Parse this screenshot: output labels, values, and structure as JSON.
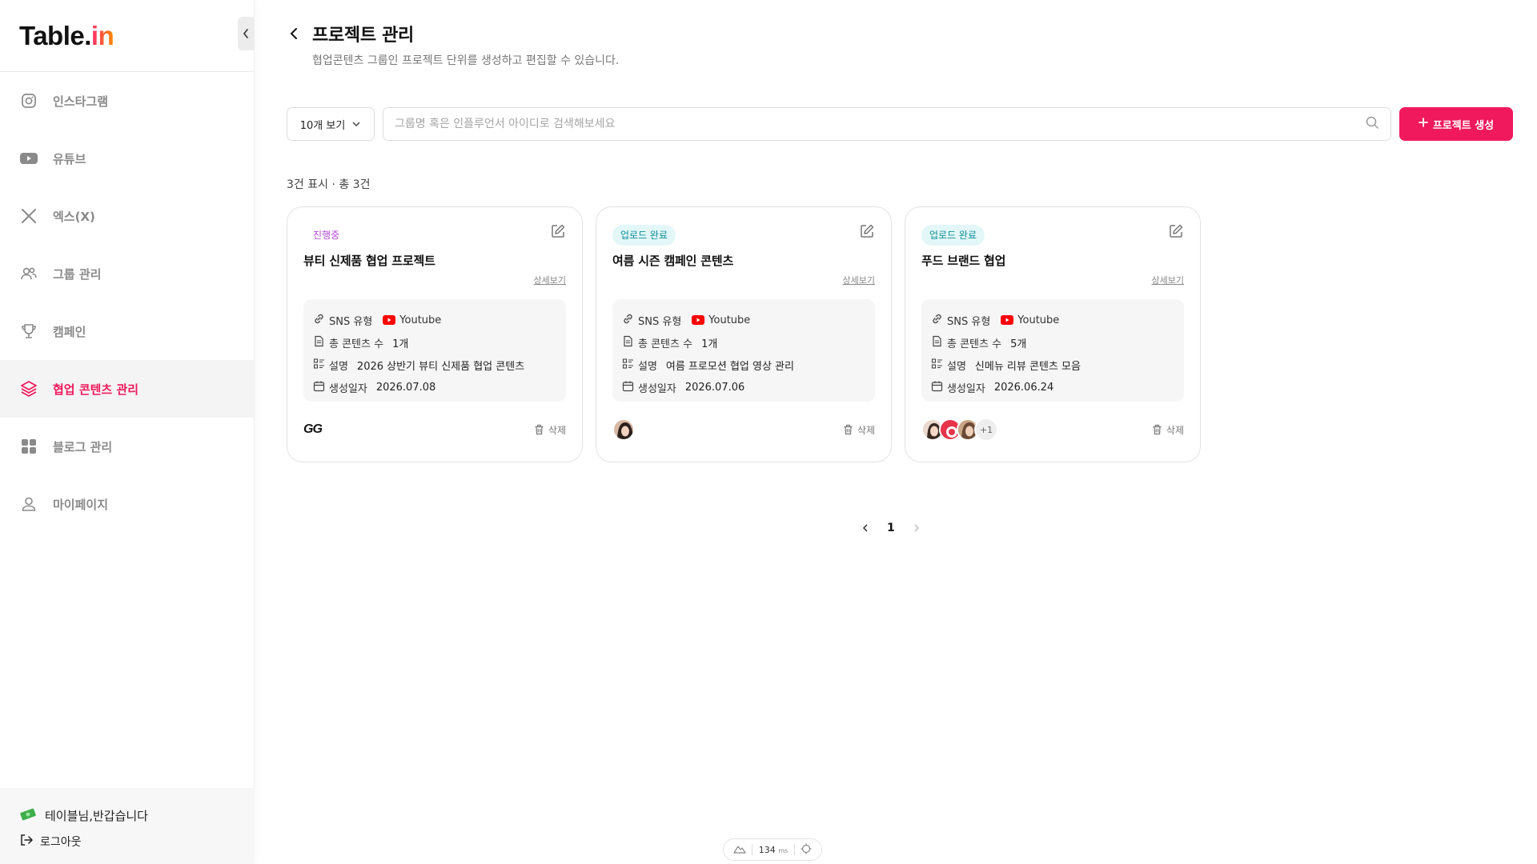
{
  "app": {
    "logo_main": "Table.",
    "logo_accent": "in"
  },
  "sidebar": {
    "items": [
      {
        "label": "인스타그램",
        "icon": "instagram-icon",
        "active": false
      },
      {
        "label": "유튜브",
        "icon": "youtube-icon",
        "active": false
      },
      {
        "label": "엑스(X)",
        "icon": "x-icon",
        "active": false
      },
      {
        "label": "그룹 관리",
        "icon": "users-icon",
        "active": false
      },
      {
        "label": "캠페인",
        "icon": "trophy-icon",
        "active": false
      },
      {
        "label": "협업 콘텐츠 관리",
        "icon": "layers-icon",
        "active": true
      },
      {
        "label": "블로그 관리",
        "icon": "grid-icon",
        "active": false
      },
      {
        "label": "마이페이지",
        "icon": "user-icon",
        "active": false
      }
    ],
    "greeting": "테이블님,반갑습니다",
    "logout": "로그아웃"
  },
  "header": {
    "title": "프로젝트 관리",
    "subtitle": "협업콘텐츠 그룹인 프로젝트 단위를 생성하고 편집할 수 있습니다."
  },
  "toolbar": {
    "per_page": "10개 보기",
    "search_placeholder": "그룹명 혹은 인플루언서 아이디로 검색해보세요",
    "search_value": "",
    "create_label": "프로젝트 생성"
  },
  "count_text": "3건 표시 · 총 3건",
  "labels": {
    "sns": "SNS 유형",
    "total": "총 콘텐츠 수",
    "desc": "설명",
    "created": "생성일자",
    "detail": "상세보기",
    "delete": "삭제"
  },
  "cards": [
    {
      "status": "진행중",
      "title": "뷰티 신제품 협업 프로젝트",
      "sns": "Youtube",
      "total": "1개",
      "desc": "2026 상반기 뷰티 신제품 협업 콘텐츠",
      "created": "2026.07.08",
      "brand": "GG"
    },
    {
      "status": "업로드 완료",
      "title": "여름 시즌 캠페인 콘텐츠",
      "sns": "Youtube",
      "total": "1개",
      "desc": "여름 프로모션 협업 영상 관리",
      "created": "2026.07.06"
    },
    {
      "status": "업로드 완료",
      "title": "푸드 브랜드 협업",
      "sns": "Youtube",
      "total": "5개",
      "desc": "신메뉴 리뷰 콘텐츠 모음",
      "created": "2026.06.24",
      "more": "+1"
    }
  ],
  "pagination": {
    "current": "1"
  },
  "perf": {
    "value": "134",
    "unit": "ms"
  },
  "colors": {
    "accent": "#f0195d",
    "done_text": "#0f8f99",
    "done_bg": "#e3f7f8",
    "progress_text": "#b44ad8",
    "youtube": "#ff0000"
  }
}
